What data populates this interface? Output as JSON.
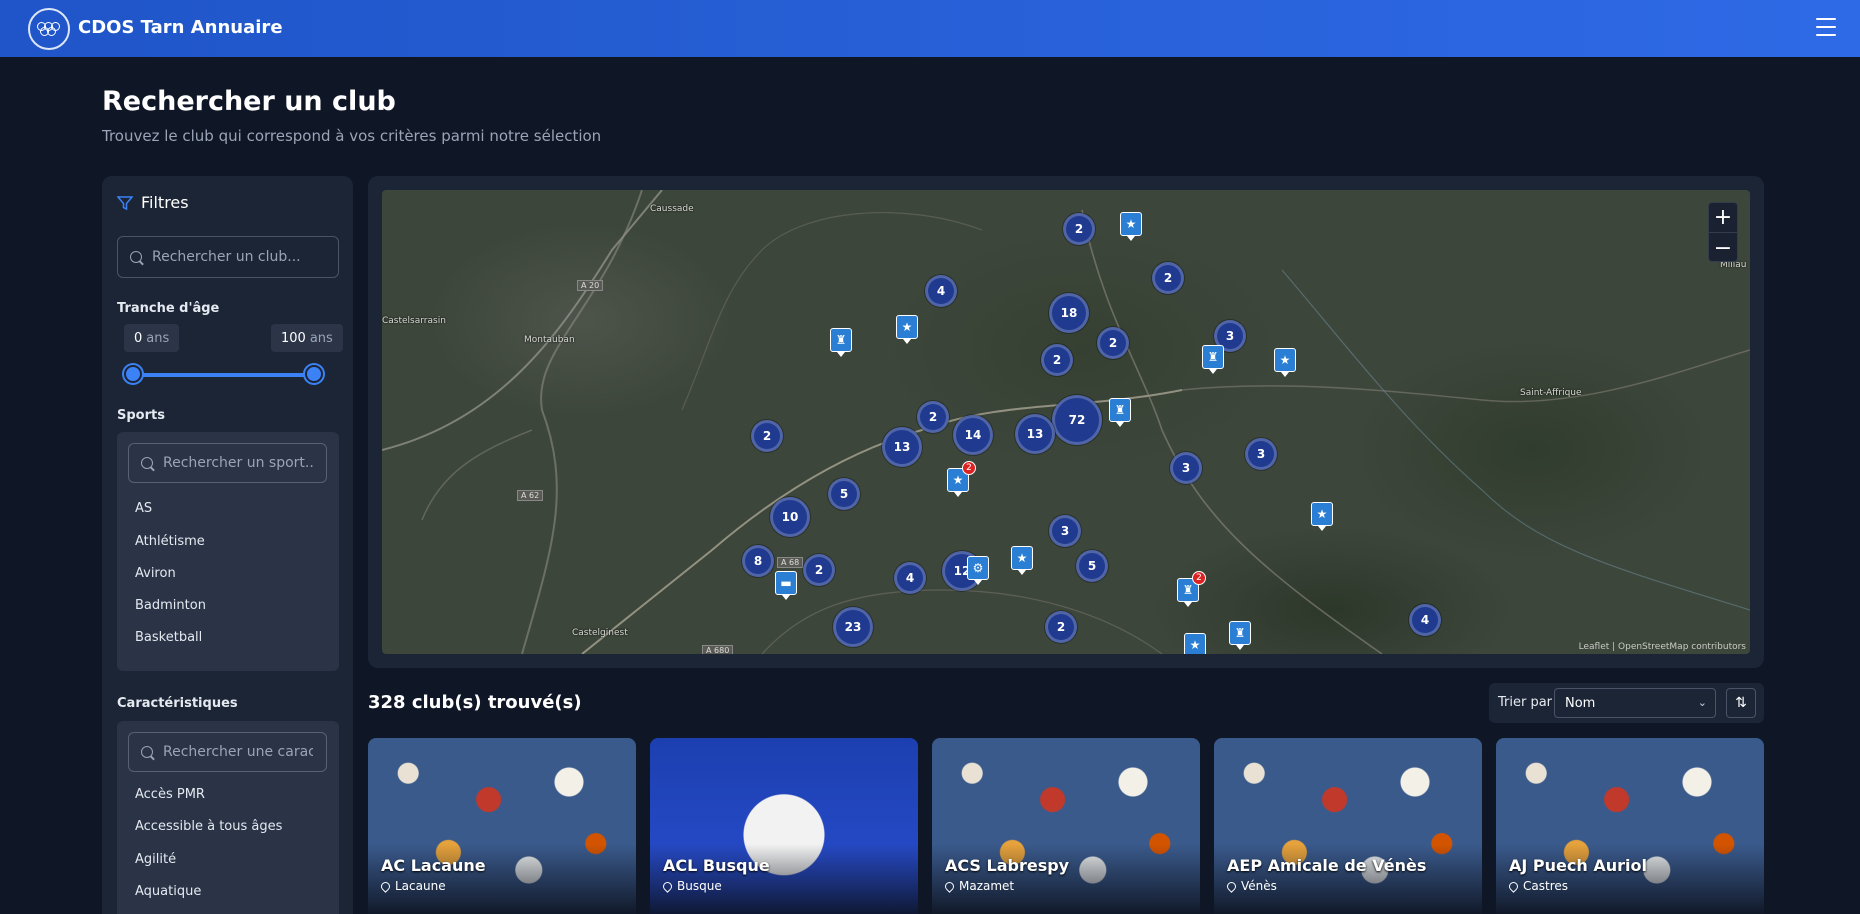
{
  "header": {
    "brand": "CDOS Tarn Annuaire",
    "logo_icon": "olympic-rings-icon",
    "menu_icon": "hamburger-menu-icon"
  },
  "page": {
    "title": "Rechercher un club",
    "subtitle": "Trouvez le club qui correspond à vos critères parmi notre sélection"
  },
  "filters": {
    "title": "Filtres",
    "search_placeholder": "Rechercher un club...",
    "age": {
      "label": "Tranche d'âge",
      "min": "0",
      "max": "100",
      "unit": "ans",
      "range_min": 0,
      "range_max": 100
    },
    "sports": {
      "label": "Sports",
      "search_placeholder": "Rechercher un sport...",
      "items": [
        "AS",
        "Athlétisme",
        "Aviron",
        "Badminton",
        "Basketball"
      ]
    },
    "features": {
      "label": "Caractéristiques",
      "search_placeholder": "Rechercher une caractéristique...",
      "items": [
        "Accès PMR",
        "Accessible à tous âges",
        "Agilité",
        "Aquatique"
      ]
    }
  },
  "map": {
    "towns": [
      "Caussade",
      "Montauban",
      "Castelginest",
      "Millau",
      "Saint-Affrique",
      "Castelsarrasin"
    ],
    "roads": [
      "A 20",
      "A 62",
      "A 68",
      "A 680"
    ],
    "clusters": [
      "2",
      "4",
      "2",
      "18",
      "2",
      "2",
      "3",
      "2",
      "72",
      "13",
      "14",
      "13",
      "2",
      "3",
      "3",
      "5",
      "10",
      "3",
      "8",
      "2",
      "4",
      "12",
      "5",
      "2",
      "23",
      "4"
    ],
    "pins": [
      "trophy",
      "running",
      "trophy",
      "running",
      "running",
      "trophy",
      "running",
      "cycling",
      "running",
      "trophy",
      "running",
      "trophy",
      "bench"
    ],
    "pin_badges": [
      "2",
      "2"
    ],
    "zoom_in": "+",
    "zoom_out": "−",
    "attribution": "Leaflet | OpenStreetMap contributors"
  },
  "results": {
    "count_text": "328 club(s) trouvé(s)",
    "sort_label": "Trier par",
    "sort_value": "Nom",
    "cards": [
      {
        "name": "AC Lacaune",
        "city": "Lacaune"
      },
      {
        "name": "ACL Busque",
        "city": "Busque"
      },
      {
        "name": "ACS Labrespy",
        "city": "Mazamet"
      },
      {
        "name": "AEP Amicale de Vénès",
        "city": "Vénès"
      },
      {
        "name": "AJ Puech Auriol",
        "city": "Castres"
      }
    ]
  },
  "colors": {
    "header": "#2f6ae6",
    "bg": "#0f1626",
    "panel": "#1c2536",
    "accent": "#3b82f6",
    "cluster": "#1f3a8f"
  }
}
